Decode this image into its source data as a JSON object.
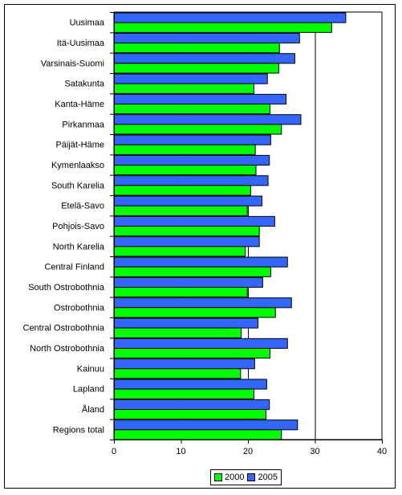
{
  "chart_data": {
    "type": "bar",
    "orientation": "horizontal",
    "title": "",
    "xlabel": "",
    "ylabel": "",
    "xlim": [
      0,
      40
    ],
    "xticks": [
      0,
      10,
      20,
      30,
      40
    ],
    "grid": "vertical major lines",
    "legend_position": "bottom-center",
    "categories": [
      "Uusimaa",
      "Itä-Uusimaa",
      "Varsinais-Suomi",
      "Satakunta",
      "Kanta-Häme",
      "Pirkanmaa",
      "Päijät-Häme",
      "Kymenlaakso",
      "South Karelia",
      "Etelä-Savo",
      "Pohjois-Savo",
      "North Karelia",
      "Central Finland",
      "South Ostrobothnia",
      "Ostrobothnia",
      "Central Ostrobothnia",
      "North Ostrobothnia",
      "Kainuu",
      "Lapland",
      "Åland",
      "Regions total"
    ],
    "series": [
      {
        "name": "2000",
        "color": "#00FF00",
        "values": [
          32.5,
          24.7,
          24.6,
          20.9,
          23.3,
          25.0,
          21.1,
          21.2,
          20.4,
          19.9,
          21.7,
          19.6,
          23.4,
          19.9,
          24.1,
          19.0,
          23.3,
          18.9,
          20.9,
          22.7,
          25.0
        ]
      },
      {
        "name": "2005",
        "color": "#3366FF",
        "values": [
          34.6,
          27.7,
          27.0,
          22.9,
          25.7,
          27.9,
          23.4,
          23.2,
          23.0,
          22.1,
          24.0,
          21.7,
          25.9,
          22.2,
          26.5,
          21.5,
          25.9,
          21.0,
          22.8,
          23.2,
          27.4
        ]
      }
    ]
  },
  "legend": [
    {
      "label": "2000",
      "color": "#00FF00"
    },
    {
      "label": "2005",
      "color": "#3366FF"
    }
  ]
}
